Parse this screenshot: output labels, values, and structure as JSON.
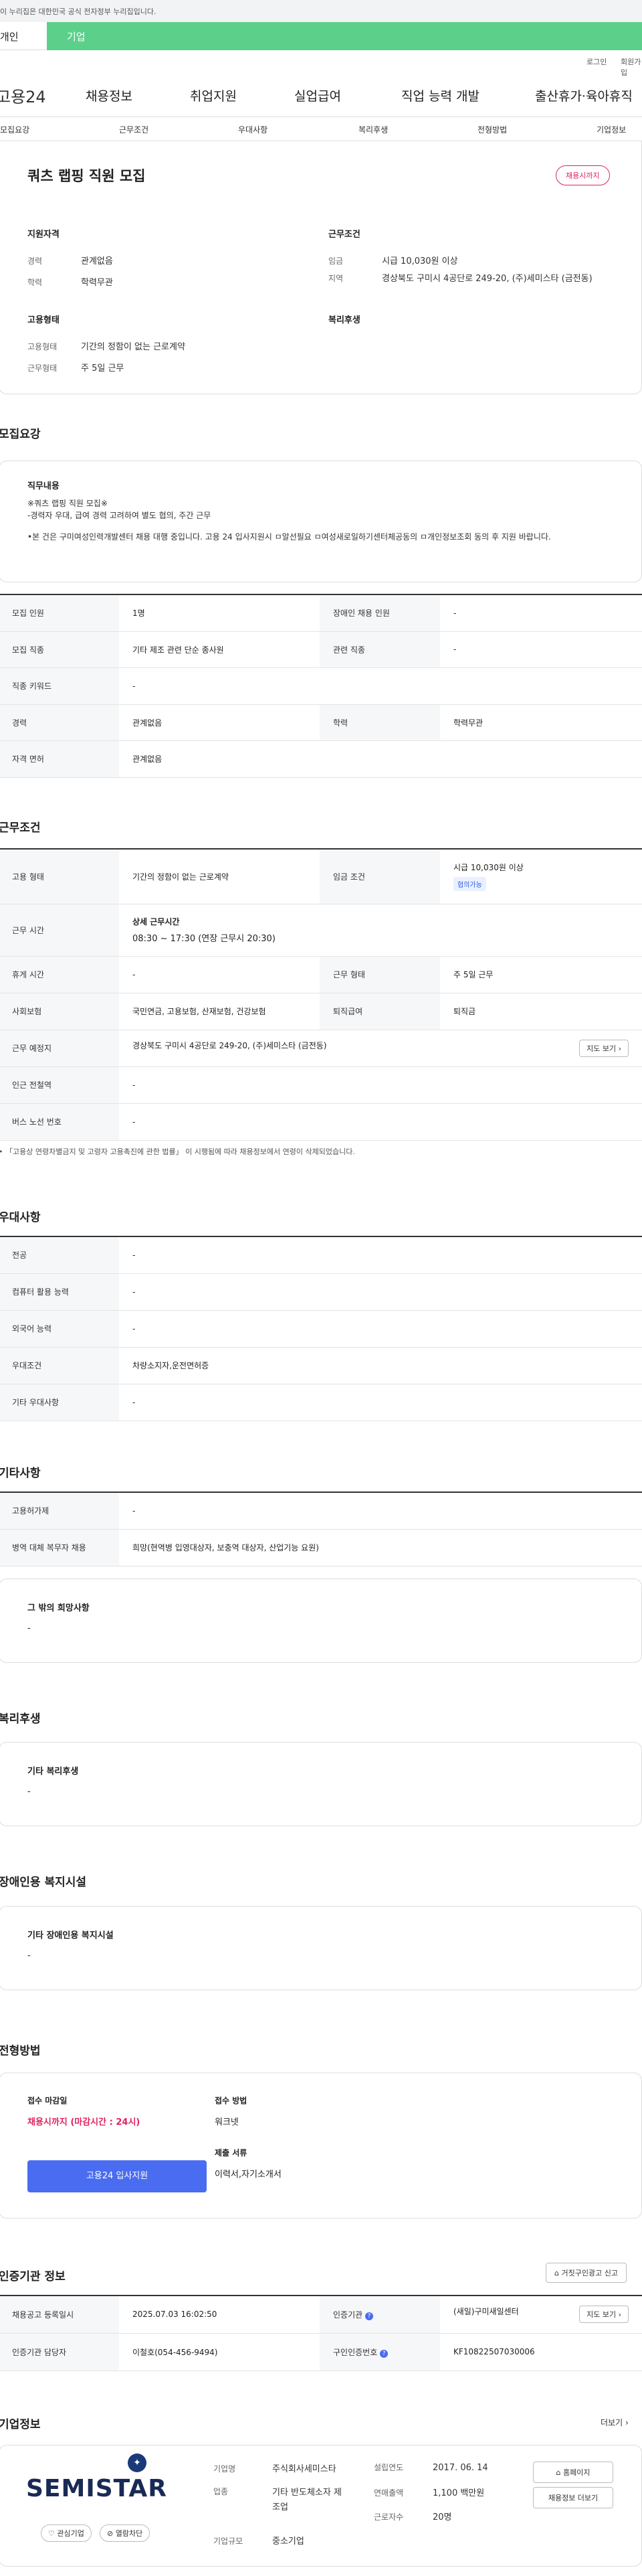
{
  "gov_banner": "이 누리집은 대한민국 공식 전자정부 누리집입니다.",
  "user_tabs": [
    "개인",
    "기업"
  ],
  "util": [
    "로그인",
    "회원가입"
  ],
  "gnb": {
    "logo": "고용24",
    "items": [
      "채용정보",
      "취업지원",
      "실업급여",
      "직업 능력 개발",
      "출산휴가·육아휴직"
    ]
  },
  "anchor_nav": [
    "모집요강",
    "근무조건",
    "우대사항",
    "복리후생",
    "전형방법",
    "기업정보"
  ],
  "job": {
    "title": "쿼츠 랩핑 직원 모집",
    "badge": "채용시까지",
    "qual_h": "지원자격",
    "career_k": "경력",
    "career_v": "관계없음",
    "edu_k": "학력",
    "edu_v": "학력무관",
    "cond_h": "근무조건",
    "wage_k": "임금",
    "wage_v": "시급 10,030원 이상",
    "area_k": "지역",
    "area_v": "경상북도 구미시 4공단로 249-20, (주)세미스타 (금전동)",
    "emp_h": "고용형태",
    "emp1_k": "고용형태",
    "emp1_v": "기간의 정함이 없는 근로계약",
    "emp2_k": "근무형태",
    "emp2_v": "주 5일 근무",
    "welfare_h": "복리후생"
  },
  "recruit": {
    "title": "모집요강",
    "desc_h": "직무내용",
    "desc_lines": [
      "※쿼츠 랩핑 직원 모집※",
      "-경력자 우대, 급여 경력 고려하여 별도 협의, 주간 근무",
      "",
      "•본 건은 구미여성인력개발센터 채용 대행 중입니다. 고용 24 입사지원시 ㅁ알선필요 ㅁ여성새로일하기센터체공동의 ㅁ개인정보조회 동의 후 지원 바랍니다."
    ],
    "rows": [
      [
        "모집 인원",
        "1명",
        "장애인 채용 인원",
        "-"
      ],
      [
        "모집 직종",
        "기타 제조 관련 단순 종사원",
        "관련 직종",
        "-"
      ],
      [
        "직종 키워드",
        "-"
      ],
      [
        "경력",
        "관계없음",
        "학력",
        "학력무관"
      ],
      [
        "자격 면허",
        "관계없음"
      ]
    ]
  },
  "workcond": {
    "title": "근무조건",
    "emp_k": "고용 형태",
    "emp_v": "기간의 정함이 없는 근로계약",
    "wage_k": "임금 조건",
    "wage_v": "시급 10,030원 이상",
    "wage_tag": "협의가능",
    "time_k": "근무 시간",
    "time_h": "상세 근무시간",
    "time_v": "08:30 ~ 17:30 (연장 근무시 20:30)",
    "rest_k": "휴게 시간",
    "rest_v": "-",
    "type_k": "근무 형태",
    "type_v": "주 5일 근무",
    "ins_k": "사회보험",
    "ins_v": "국민연금, 고용보험, 산재보험, 건강보험",
    "ret_k": "퇴직급여",
    "ret_v": "퇴직금",
    "loc_k": "근무 예정지",
    "loc_v": "경상북도 구미시 4공단로 249-20, (주)세미스타 (금전동)",
    "map_btn": "지도 보기",
    "sub_k": "인근 전철역",
    "sub_v": "-",
    "bus_k": "버스 노선 번호",
    "bus_v": "-",
    "note": "• 「고용상 연령차별금지 및 고령자 고용촉진에 관한 법률」 이 시행됨에 따라 채용정보에서 연령이 삭제되었습니다."
  },
  "pref": {
    "title": "우대사항",
    "rows": [
      [
        "전공",
        "-"
      ],
      [
        "컴퓨터 활용 능력",
        "-"
      ],
      [
        "외국어 능력",
        "-"
      ],
      [
        "우대조건",
        "차량소지자,운전면허증"
      ],
      [
        "기타 우대사항",
        "-"
      ]
    ]
  },
  "etc": {
    "title": "기타사항",
    "rows": [
      [
        "고용허가제",
        "-"
      ],
      [
        "병역 대체 복무자 채용",
        "희망(현역병 입영대상자, 보충역 대상자, 산업기능 요원)"
      ]
    ],
    "hope_h": "그 밖의 희망사항",
    "hope_v": "-"
  },
  "welfare": {
    "title": "복리후생",
    "h": "기타 복리후생",
    "v": "-"
  },
  "disab": {
    "title": "장애인용 복지시설",
    "h": "기타 장애인용 복지시설",
    "v": "-"
  },
  "process": {
    "title": "전형방법",
    "due_h": "접수 마감일",
    "due_v": "채용시까지 (마감시간 : 24시)",
    "apply_btn": "고용24 입사지원",
    "method_h": "접수 방법",
    "method_v": "워크넷",
    "docs_h": "제출 서류",
    "docs_v": "이력서,자기소개서"
  },
  "agency": {
    "title": "인증기관 정보",
    "report_btn": "거짓구인광고 신고",
    "reg_k": "채용공고 등록일시",
    "reg_v": "2025.07.03 16:02:50",
    "cert_k": "인증기관",
    "cert_v": "(새일)구미새일센터",
    "map_btn": "지도 보기",
    "mgr_k": "인증기관 담당자",
    "mgr_v": "이철호(054-456-9494)",
    "num_k": "구인인증번호",
    "num_v": "KF10822507030006"
  },
  "company": {
    "title": "기업정보",
    "more": "더보기",
    "logo": "SEMISTAR",
    "fav": "관심기업",
    "open": "열람차단",
    "name_k": "기업명",
    "name_v": "주식회사세미스타",
    "ind_k": "업종",
    "ind_v": "기타 반도체소자 제조업",
    "size_k": "기업규모",
    "size_v": "중소기업",
    "est_k": "설립연도",
    "est_v": "2017. 06. 14",
    "sales_k": "연매출액",
    "sales_v": "1,100 백만원",
    "emp_k": "근로자수",
    "emp_v": "20명",
    "home_btn": "홈페이지",
    "job_btn": "채용정보 더보기"
  }
}
